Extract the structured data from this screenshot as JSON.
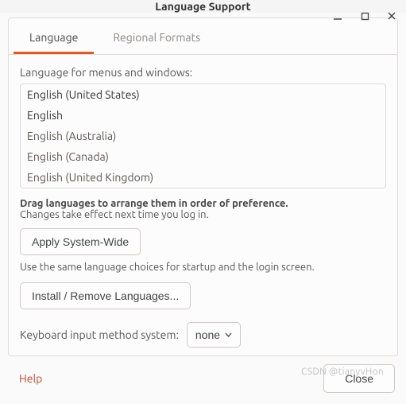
{
  "window": {
    "title": "Language Support"
  },
  "tabs": {
    "language": "Language",
    "regional": "Regional Formats"
  },
  "pane": {
    "listLabel": "Language for menus and windows:",
    "languages": [
      "English (United States)",
      "English",
      "English (Australia)",
      "English (Canada)",
      "English (United Kingdom)"
    ],
    "dragHint": "Drag languages to arrange them in order of preference.",
    "loginHint": "Changes take effect next time you log in.",
    "applyBtn": "Apply System-Wide",
    "applyNote": "Use the same language choices for startup and the login screen.",
    "installBtn": "Install / Remove Languages...",
    "kbdLabel": "Keyboard input method system:",
    "kbdValue": "none"
  },
  "footer": {
    "help": "Help",
    "close": "Close"
  },
  "watermark": "CSDN @tianyvHon"
}
